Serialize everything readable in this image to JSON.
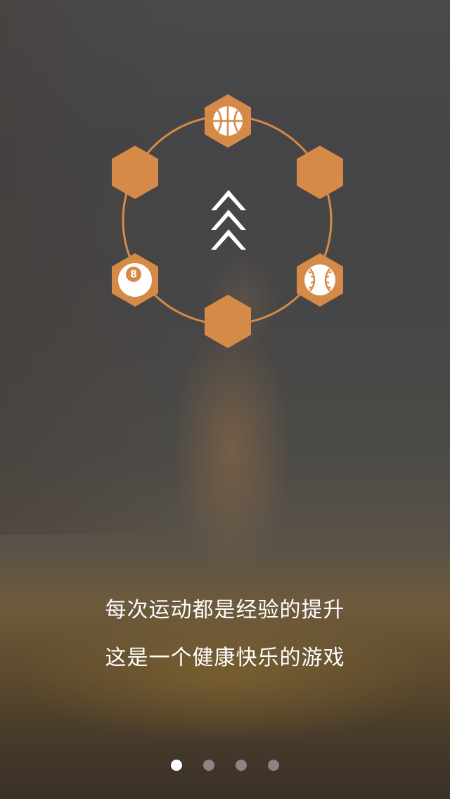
{
  "onboarding": {
    "line1": "每次运动都是经验的提升",
    "line2": "这是一个健康快乐的游戏",
    "accent_color": "#d68a47",
    "center_icon": "triple-chevron-up-icon",
    "hexagons": [
      {
        "icon": "basketball-icon"
      },
      {
        "icon": "none"
      },
      {
        "icon": "baseball-icon"
      },
      {
        "icon": "none"
      },
      {
        "icon": "billiard-8-ball-icon",
        "label": "8"
      },
      {
        "icon": "none"
      }
    ]
  },
  "pagination": {
    "total": 4,
    "active_index": 0
  }
}
